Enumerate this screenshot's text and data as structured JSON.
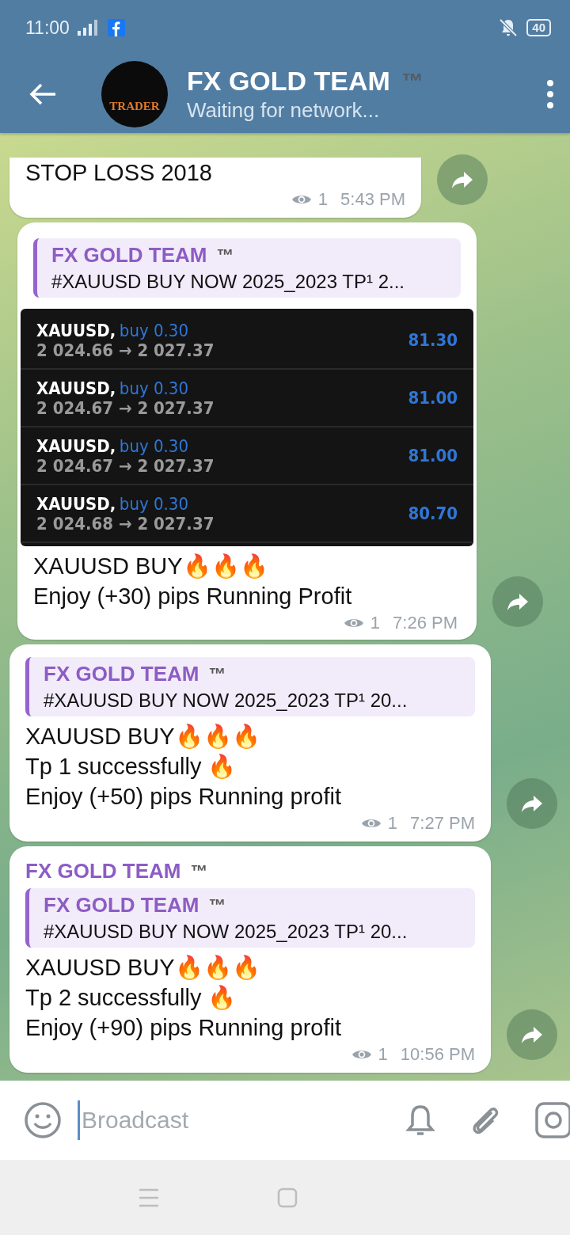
{
  "status_bar": {
    "time": "11:00",
    "battery": "40"
  },
  "header": {
    "title": "FX GOLD TEAM",
    "title_badge": "™",
    "subtitle": "Waiting for network...",
    "avatar_text": "TRADER"
  },
  "messages": [
    {
      "kind": "partial",
      "lines": [
        "STOP LOSS 2018"
      ],
      "views": "1",
      "time": "5:43 PM"
    },
    {
      "kind": "trade",
      "reply": {
        "author": "FX GOLD TEAM",
        "author_badge": "™",
        "text": "#XAUUSD BUY NOW 2025_2023  TP¹ 2..."
      },
      "media": {
        "rows": [
          {
            "symbol": "XAUUSD,",
            "side": "buy 0.30",
            "prices": "2 024.66 → 2 027.37",
            "profit": "81.30"
          },
          {
            "symbol": "XAUUSD,",
            "side": "buy 0.30",
            "prices": "2 024.67 → 2 027.37",
            "profit": "81.00"
          },
          {
            "symbol": "XAUUSD,",
            "side": "buy 0.30",
            "prices": "2 024.67 → 2 027.37",
            "profit": "81.00"
          },
          {
            "symbol": "XAUUSD,",
            "side": "buy 0.30",
            "prices": "2 024.68 → 2 027.37",
            "profit": "80.70"
          }
        ]
      },
      "lines": [
        "XAUUSD BUY🔥🔥🔥",
        "Enjoy (+30) pips Running Profit"
      ],
      "views": "1",
      "time": "7:26 PM"
    },
    {
      "kind": "text",
      "reply": {
        "author": "FX GOLD TEAM",
        "author_badge": "™",
        "text": "#XAUUSD BUY NOW 2025_2023  TP¹ 20..."
      },
      "lines": [
        "XAUUSD BUY🔥🔥🔥",
        "Tp 1 successfully 🔥",
        "Enjoy (+50) pips Running profit"
      ],
      "views": "1",
      "time": "7:27 PM"
    },
    {
      "kind": "text",
      "author": "FX GOLD TEAM",
      "author_badge": "™",
      "reply": {
        "author": "FX GOLD TEAM",
        "author_badge": "™",
        "text": "#XAUUSD BUY NOW 2025_2023  TP¹ 20..."
      },
      "lines": [
        "XAUUSD BUY🔥🔥🔥",
        "Tp 2 successfully 🔥",
        "Enjoy (+90) pips Running profit"
      ],
      "views": "1",
      "time": "10:56 PM"
    }
  ],
  "composer": {
    "placeholder": "Broadcast"
  }
}
